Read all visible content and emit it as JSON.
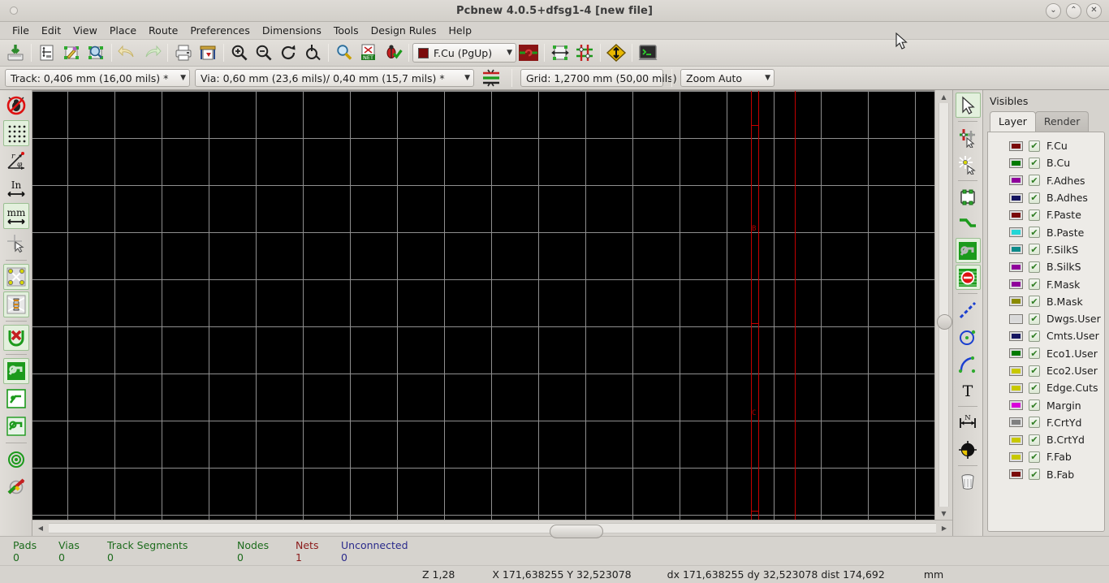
{
  "window": {
    "title": "Pcbnew 4.0.5+dfsg1-4  [new file]",
    "btn_minimize": "⌄",
    "btn_maximize": "⌃",
    "btn_close": "✕"
  },
  "menu": {
    "items": [
      {
        "label": "File"
      },
      {
        "label": "Edit"
      },
      {
        "label": "View"
      },
      {
        "label": "Place"
      },
      {
        "label": "Route"
      },
      {
        "label": "Preferences"
      },
      {
        "label": "Dimensions"
      },
      {
        "label": "Tools"
      },
      {
        "label": "Design Rules"
      },
      {
        "label": "Help"
      }
    ]
  },
  "main_toolbar": {
    "buttons": [
      {
        "name": "save-board-button",
        "tip": "Save board"
      },
      {
        "name": "page-settings-button",
        "tip": "Page settings"
      },
      {
        "name": "open-module-editor-button",
        "tip": "Open module editor"
      },
      {
        "name": "open-module-viewer-button",
        "tip": "Open module viewer"
      },
      {
        "name": "undo-button",
        "tip": "Undo"
      },
      {
        "name": "redo-button",
        "tip": "Redo"
      },
      {
        "name": "print-board-button",
        "tip": "Print board"
      },
      {
        "name": "plot-button",
        "tip": "Plot"
      },
      {
        "name": "zoom-in-button",
        "tip": "Zoom in"
      },
      {
        "name": "zoom-out-button",
        "tip": "Zoom out"
      },
      {
        "name": "zoom-redraw-button",
        "tip": "Redraw view"
      },
      {
        "name": "zoom-fit-button",
        "tip": "Zoom to fit"
      },
      {
        "name": "find-button",
        "tip": "Find"
      },
      {
        "name": "netlist-button",
        "tip": "Read netlist"
      },
      {
        "name": "drc-button",
        "tip": "Perform design rules check"
      }
    ],
    "layer_select": {
      "value": "F.Cu (PgUp)",
      "color": "#7a0a0a",
      "arrow": "▼"
    },
    "buttons_right": [
      {
        "name": "via-mode-button",
        "tip": "Via mode"
      },
      {
        "name": "mode-footprint-button",
        "tip": "Mode footprint"
      },
      {
        "name": "mode-track-button",
        "tip": "Mode track"
      },
      {
        "name": "drc-off-button",
        "tip": "DRC off"
      },
      {
        "name": "show-board-3d-button",
        "tip": "3D viewer"
      }
    ]
  },
  "aux_toolbar": {
    "track_width": {
      "label": "Track: 0,406 mm (16,00 mils) *",
      "arrow": "▼"
    },
    "via_size": {
      "label": "Via: 0,60 mm (23,6 mils)/ 0,40 mm (15,7 mils) *",
      "arrow": "▼"
    },
    "netclass_button": {
      "name": "netclass-icon"
    },
    "grid": {
      "label": "Grid: 1,2700 mm (50,00 mils)",
      "arrow": "▼"
    },
    "zoom": {
      "label": "Zoom Auto",
      "arrow": "▼"
    }
  },
  "left_toolbar": {
    "items": [
      {
        "name": "drc-off-toggle",
        "active": false
      },
      {
        "name": "grid-display-toggle",
        "active": true
      },
      {
        "name": "polar-coords-toggle",
        "active": false
      },
      {
        "name": "units-inches-toggle",
        "active": false
      },
      {
        "name": "units-mm-toggle",
        "active": true
      },
      {
        "name": "cursor-shape-toggle",
        "active": false
      },
      {
        "name": "show-ratsnest-toggle",
        "active": true
      },
      {
        "name": "show-module-ratsnest-toggle",
        "active": true
      },
      {
        "name": "auto-delete-track-toggle",
        "active": true
      },
      {
        "name": "show-zones-filled-toggle",
        "active": true
      },
      {
        "name": "show-zones-disabled-toggle",
        "active": false
      },
      {
        "name": "show-zones-outline-toggle",
        "active": false
      },
      {
        "name": "high-contrast-mode-toggle",
        "active": false
      },
      {
        "name": "microwave-tools-toggle",
        "active": false
      }
    ]
  },
  "right_toolbar": {
    "items": [
      {
        "name": "select-tool",
        "active": true
      },
      {
        "name": "highlight-net-tool",
        "active": false
      },
      {
        "name": "local-ratsnest-tool",
        "active": false
      },
      {
        "name": "add-footprint-tool",
        "active": false
      },
      {
        "name": "add-track-tool",
        "active": false
      },
      {
        "name": "add-zone-tool",
        "active": true
      },
      {
        "name": "add-keepout-zone-tool",
        "active": true
      },
      {
        "name": "add-graphic-line-tool",
        "active": false
      },
      {
        "name": "add-graphic-circle-tool",
        "active": false
      },
      {
        "name": "add-graphic-arc-tool",
        "active": false
      },
      {
        "name": "add-text-tool",
        "active": false
      },
      {
        "name": "add-dimension-tool",
        "active": false
      },
      {
        "name": "add-target-tool",
        "active": false
      },
      {
        "name": "delete-tool",
        "active": false
      }
    ]
  },
  "visibles_panel": {
    "title": "Visibles",
    "tabs": [
      {
        "label": "Layer",
        "active": true
      },
      {
        "label": "Render",
        "active": false
      }
    ],
    "layers": [
      {
        "name": "F.Cu",
        "color": "#7a0a0a",
        "checked": true
      },
      {
        "name": "B.Cu",
        "color": "#007a00",
        "checked": true
      },
      {
        "name": "F.Adhes",
        "color": "#8f009b",
        "checked": true
      },
      {
        "name": "B.Adhes",
        "color": "#151560",
        "checked": true
      },
      {
        "name": "F.Paste",
        "color": "#7a0a0a",
        "checked": true
      },
      {
        "name": "B.Paste",
        "color": "#23d6d6",
        "checked": true
      },
      {
        "name": "F.SilkS",
        "color": "#0d8a8a",
        "checked": true
      },
      {
        "name": "B.SilkS",
        "color": "#8f009b",
        "checked": true
      },
      {
        "name": "F.Mask",
        "color": "#8f009b",
        "checked": true
      },
      {
        "name": "B.Mask",
        "color": "#8a8a00",
        "checked": true
      },
      {
        "name": "Dwgs.User",
        "color": "#d9d9d9",
        "checked": true
      },
      {
        "name": "Cmts.User",
        "color": "#151560",
        "checked": true
      },
      {
        "name": "Eco1.User",
        "color": "#007a00",
        "checked": true
      },
      {
        "name": "Eco2.User",
        "color": "#c8c800",
        "checked": true
      },
      {
        "name": "Edge.Cuts",
        "color": "#c8c800",
        "checked": true
      },
      {
        "name": "Margin",
        "color": "#d900d9",
        "checked": true
      },
      {
        "name": "F.CrtYd",
        "color": "#808080",
        "checked": true
      },
      {
        "name": "B.CrtYd",
        "color": "#c8c800",
        "checked": true
      },
      {
        "name": "F.Fab",
        "color": "#c8c800",
        "checked": true
      },
      {
        "name": "B.Fab",
        "color": "#7a0a0a",
        "checked": true
      }
    ],
    "check_glyph": "✔"
  },
  "canvas": {
    "background": "#000000",
    "grid_color": "#8f8f8f",
    "grid_spacing_px": 58,
    "page_frame_color": "#c50000",
    "markers": [
      {
        "label": "B"
      },
      {
        "label": "C"
      }
    ]
  },
  "statusbar": {
    "counts": [
      {
        "label": "Pads",
        "value": "0",
        "color": "#1c6b1c"
      },
      {
        "label": "Vias",
        "value": "0",
        "color": "#1c6b1c"
      },
      {
        "label": "Track Segments",
        "value": "0",
        "color": "#1c6b1c"
      },
      {
        "label": "Nodes",
        "value": "0",
        "color": "#1c6b1c"
      },
      {
        "label": "Nets",
        "value": "1",
        "color": "#8b1a1a"
      },
      {
        "label": "Unconnected",
        "value": "0",
        "color": "#2a2a8b"
      }
    ],
    "zoom": "Z 1,28",
    "xy": "X 171,638255 Y 32,523078",
    "delta": "dx 171,638255 dy 32,523078 dist 174,692",
    "units": "mm"
  }
}
